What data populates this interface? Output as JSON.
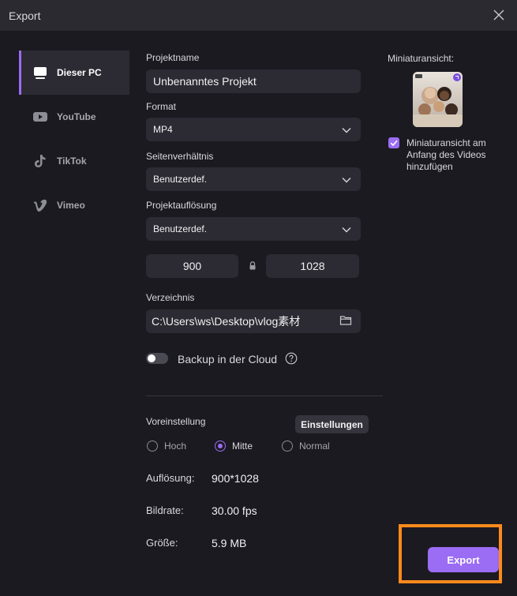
{
  "window": {
    "title": "Export"
  },
  "sidebar": {
    "items": [
      {
        "label": "Dieser PC",
        "icon": "monitor-icon",
        "active": true
      },
      {
        "label": "YouTube",
        "icon": "youtube-icon",
        "active": false
      },
      {
        "label": "TikTok",
        "icon": "tiktok-icon",
        "active": false
      },
      {
        "label": "Vimeo",
        "icon": "vimeo-icon",
        "active": false
      }
    ]
  },
  "form": {
    "project_name_label": "Projektname",
    "project_name_value": "Unbenanntes Projekt",
    "format_label": "Format",
    "format_value": "MP4",
    "aspect_label": "Seitenverhältnis",
    "aspect_value": "Benutzerdef.",
    "resolution_label": "Projektauflösung",
    "resolution_value": "Benutzerdef.",
    "width_value": "900",
    "height_value": "1028",
    "directory_label": "Verzeichnis",
    "directory_value": "C:\\Users\\ws\\Desktop\\vlog素材",
    "backup_label": "Backup in der Cloud",
    "backup_enabled": false
  },
  "preset": {
    "label": "Voreinstellung",
    "settings_button": "Einstellungen",
    "options": [
      {
        "label": "Hoch",
        "selected": false
      },
      {
        "label": "Mitte",
        "selected": true
      },
      {
        "label": "Normal",
        "selected": false
      }
    ]
  },
  "info": {
    "resolution_label": "Auflösung:",
    "resolution_value": "900*1028",
    "framerate_label": "Bildrate:",
    "framerate_value": "30.00 fps",
    "size_label": "Größe:",
    "size_value": "5.9 MB"
  },
  "thumbnail": {
    "label": "Miniaturansicht:",
    "checkbox_label": "Miniaturansicht am Anfang des Videos hinzufügen",
    "checkbox_checked": true
  },
  "footer": {
    "export_label": "Export"
  },
  "colors": {
    "accent": "#9b6cf4",
    "highlight": "#ff8a1c",
    "background": "#1b1a21"
  }
}
